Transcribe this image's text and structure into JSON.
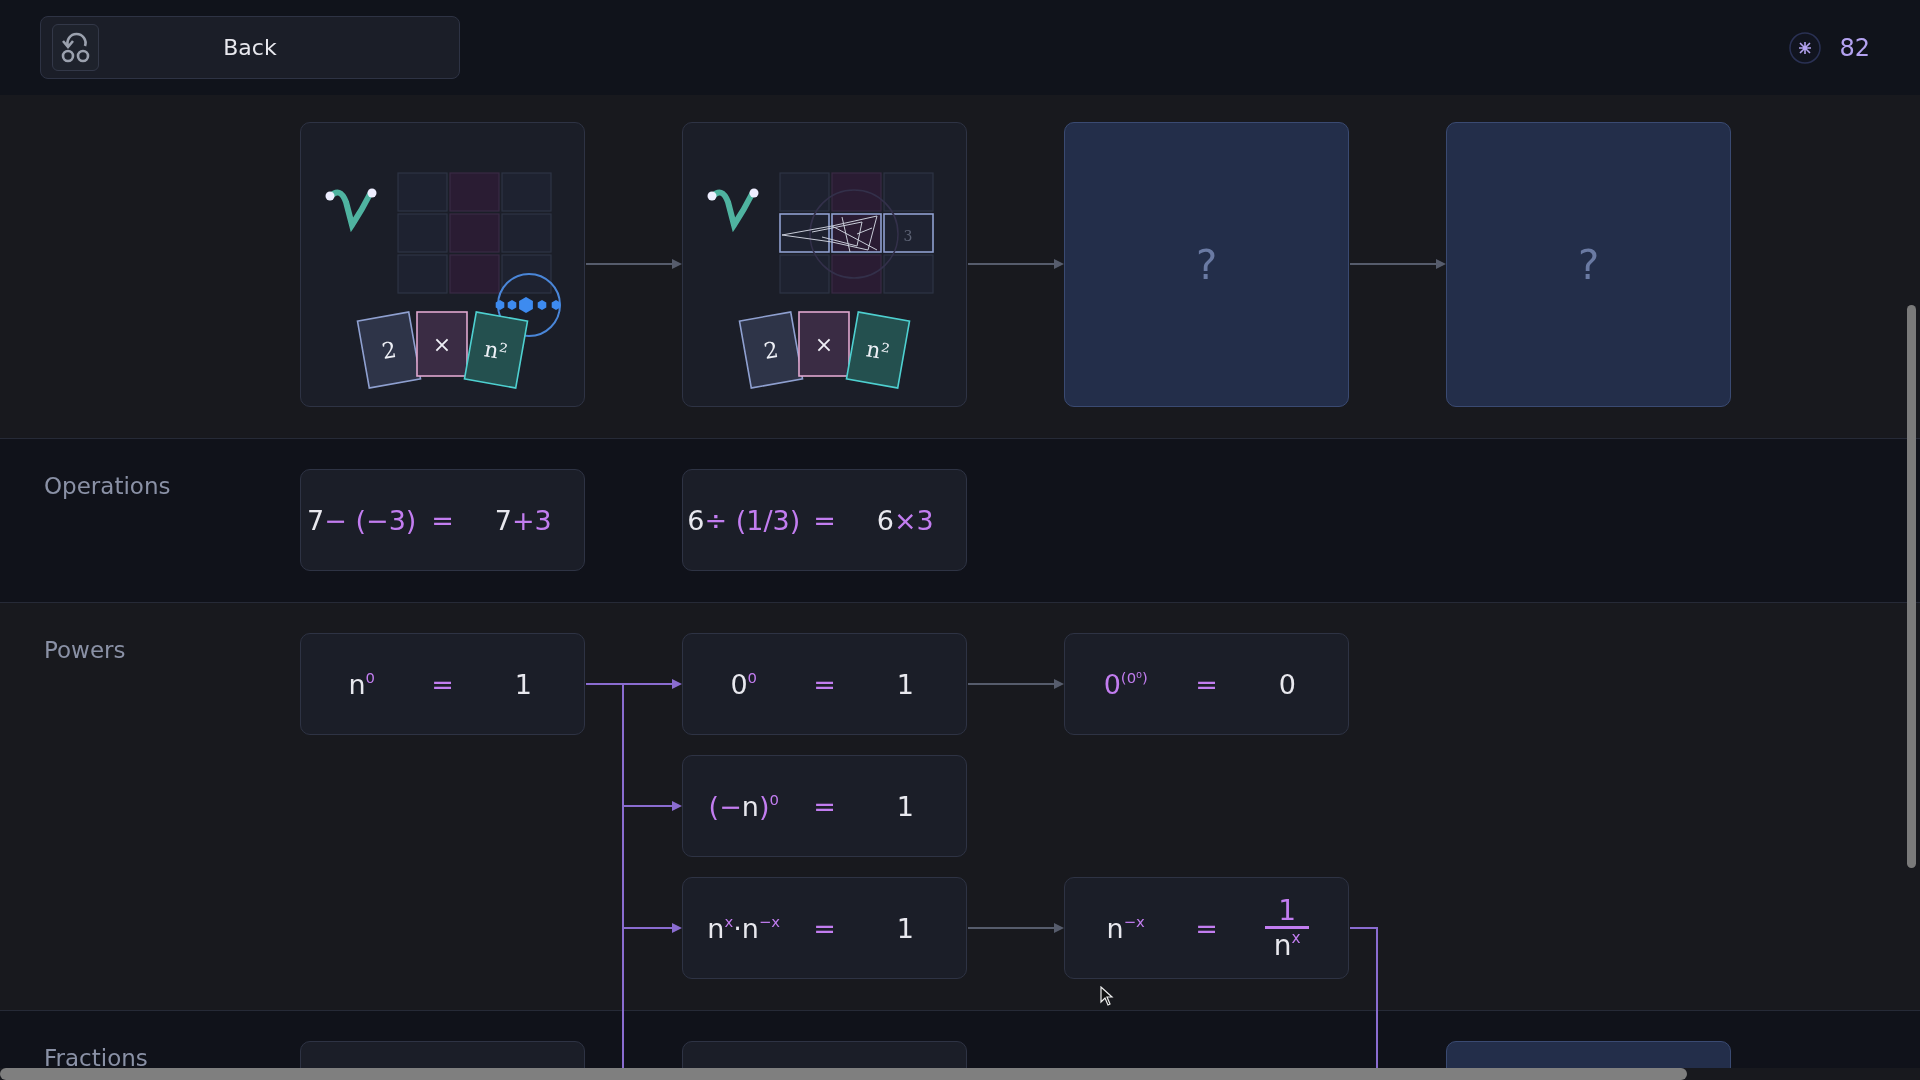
{
  "header": {
    "back_label": "Back",
    "coins": "82"
  },
  "levels": [
    {
      "kind": "drag_preview",
      "tiles": [
        "2",
        "×",
        "n²"
      ]
    },
    {
      "kind": "web_preview",
      "tiles": [
        "2",
        "×",
        "n²"
      ],
      "cell_text": "3"
    },
    {
      "kind": "locked",
      "label": "?"
    },
    {
      "kind": "locked",
      "label": "?"
    }
  ],
  "sections": [
    {
      "title": "Operations",
      "rows": [
        [
          {
            "kind": "formula",
            "lhs": {
              "kind": "plain",
              "parts": [
                {
                  "t": "7"
                },
                {
                  "t": "− (−3)",
                  "accent": true
                }
              ]
            },
            "eq": "=",
            "rhs": {
              "kind": "plain",
              "parts": [
                {
                  "t": "7"
                },
                {
                  "t": "+3",
                  "accent": true
                }
              ]
            }
          },
          {
            "kind": "formula",
            "lhs": {
              "kind": "plain",
              "parts": [
                {
                  "t": "6"
                },
                {
                  "t": "÷ (1/3)",
                  "accent": true
                }
              ]
            },
            "eq": "=",
            "rhs": {
              "kind": "plain",
              "parts": [
                {
                  "t": "6"
                },
                {
                  "t": "×3",
                  "accent": true
                }
              ]
            }
          },
          null,
          null
        ]
      ]
    },
    {
      "title": "Powers",
      "rows": [
        [
          {
            "kind": "formula",
            "lhs": {
              "kind": "plain",
              "parts": [
                {
                  "t": "n"
                },
                {
                  "t": "0",
                  "accent": true,
                  "sup": true
                }
              ]
            },
            "eq": "=",
            "rhs": {
              "kind": "plain",
              "parts": [
                {
                  "t": "1"
                }
              ]
            }
          },
          {
            "kind": "formula",
            "lhs": {
              "kind": "plain",
              "parts": [
                {
                  "t": "0"
                },
                {
                  "t": "0",
                  "accent": true,
                  "sup": true
                }
              ]
            },
            "eq": "=",
            "rhs": {
              "kind": "plain",
              "parts": [
                {
                  "t": "1"
                }
              ]
            }
          },
          {
            "kind": "formula",
            "lhs": {
              "kind": "plain",
              "parts": [
                {
                  "t": "0",
                  "accent": true
                },
                {
                  "t": "(0⁰)",
                  "accent": true,
                  "sup": true
                }
              ]
            },
            "eq": "=",
            "rhs": {
              "kind": "plain",
              "parts": [
                {
                  "t": "0"
                }
              ]
            }
          },
          null
        ],
        [
          null,
          {
            "kind": "formula",
            "lhs": {
              "kind": "plain",
              "parts": [
                {
                  "t": "(−",
                  "accent": true
                },
                {
                  "t": "n"
                },
                {
                  "t": ")",
                  "accent": true
                },
                {
                  "t": "0",
                  "accent": true,
                  "sup": true
                }
              ]
            },
            "eq": "=",
            "rhs": {
              "kind": "plain",
              "parts": [
                {
                  "t": "1"
                }
              ]
            }
          },
          null,
          null
        ],
        [
          null,
          {
            "kind": "formula",
            "lhs": {
              "kind": "plain",
              "parts": [
                {
                  "t": "n"
                },
                {
                  "t": "x",
                  "accent": true,
                  "sup": true
                },
                {
                  "t": "·n"
                },
                {
                  "t": "−x",
                  "accent": true,
                  "sup": true
                }
              ]
            },
            "eq": "=",
            "rhs": {
              "kind": "plain",
              "parts": [
                {
                  "t": "1"
                }
              ]
            }
          },
          {
            "kind": "formula",
            "lhs": {
              "kind": "plain",
              "parts": [
                {
                  "t": "n"
                },
                {
                  "t": "−x",
                  "accent": true,
                  "sup": true
                }
              ]
            },
            "eq": "=",
            "rhs": {
              "kind": "fraction",
              "num": [
                {
                  "t": "1",
                  "accent": true
                }
              ],
              "den": [
                {
                  "t": "n"
                },
                {
                  "t": "x",
                  "accent": true,
                  "sup": true
                }
              ]
            }
          },
          null
        ]
      ]
    },
    {
      "title": "Fractions",
      "rows": [
        [
          {
            "kind": "blank"
          },
          {
            "kind": "blank"
          },
          null,
          {
            "kind": "locked"
          }
        ]
      ]
    }
  ]
}
